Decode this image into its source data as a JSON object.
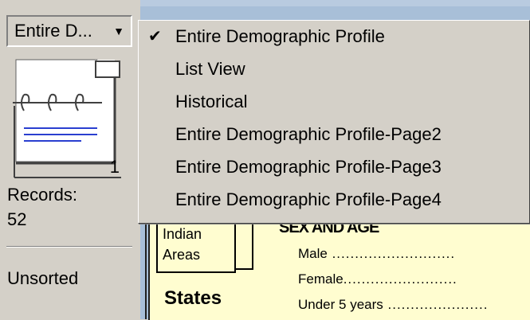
{
  "left_panel": {
    "layout_select_value": "Entire D...",
    "page_number": "1",
    "records_label": "Records:",
    "records_count": "52",
    "sort_status": "Unsorted"
  },
  "layout_menu": {
    "items": [
      {
        "label": "Entire Demographic Profile",
        "checked": true
      },
      {
        "label": "List View",
        "checked": false
      },
      {
        "label": "Historical",
        "checked": false
      },
      {
        "label": "Entire Demographic Profile-Page2",
        "checked": false
      },
      {
        "label": "Entire Demographic Profile-Page3",
        "checked": false
      },
      {
        "label": "Entire Demographic Profile-Page4",
        "checked": false
      }
    ],
    "check_glyph": "✔"
  },
  "content": {
    "indian_areas_line1": "Indian",
    "indian_areas_line2": "Areas",
    "section_heading": "SEX AND AGE",
    "states_label": "States",
    "rows": [
      {
        "label": "Male",
        "leader": " ..........................."
      },
      {
        "label": "Female",
        "leader": "........................."
      },
      {
        "label": "Under 5 years",
        "leader": " ......................"
      }
    ]
  },
  "colors": {
    "panel_bg": "#d4d0c8",
    "canvas_bg": "#fffdd0",
    "content_bg": "#a8bfd8",
    "book_line": "#2a3fd0"
  },
  "icons": {
    "layout_caret": "down-caret-icon",
    "book": "book-navigator-icon"
  }
}
